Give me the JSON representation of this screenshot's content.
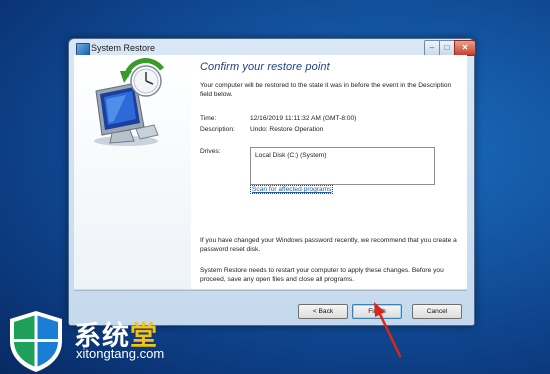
{
  "window": {
    "title": "System Restore",
    "min_label": "–",
    "max_label": "□",
    "close_label": "✕"
  },
  "content": {
    "heading": "Confirm your restore point",
    "intro": "Your computer will be restored to the state it was in before the event in the Description field below.",
    "time_label": "Time:",
    "time_value": "12/16/2019 11:11:32 AM (GMT-8:00)",
    "description_label": "Description:",
    "description_value": "Undo: Restore Operation",
    "drives_label": "Drives:",
    "drives_items": [
      "Local Disk (C:) (System)"
    ],
    "scan_link": "Scan for affected programs",
    "password_note": "If you have changed your Windows password recently, we recommend that you create a password reset disk.",
    "restart_note": "System Restore needs to restart your computer to apply these changes. Before you proceed, save any open files and close all programs."
  },
  "buttons": {
    "back": "< Back",
    "finish": "Finish",
    "cancel": "Cancel"
  },
  "watermark": {
    "brand_part1": "系统",
    "brand_part2": "堂",
    "url": "xitongtang.com"
  },
  "colors": {
    "desktop": "#1456a4",
    "heading": "#1f3f8a",
    "link": "#1f5fb4",
    "arrow": "#d9261c",
    "watermark_accent": "#f3c01c"
  },
  "icons": {
    "title_icon": "system-restore-icon",
    "illustration": "computer-restore-clock-icon",
    "annotation": "red-arrow-pointer"
  }
}
